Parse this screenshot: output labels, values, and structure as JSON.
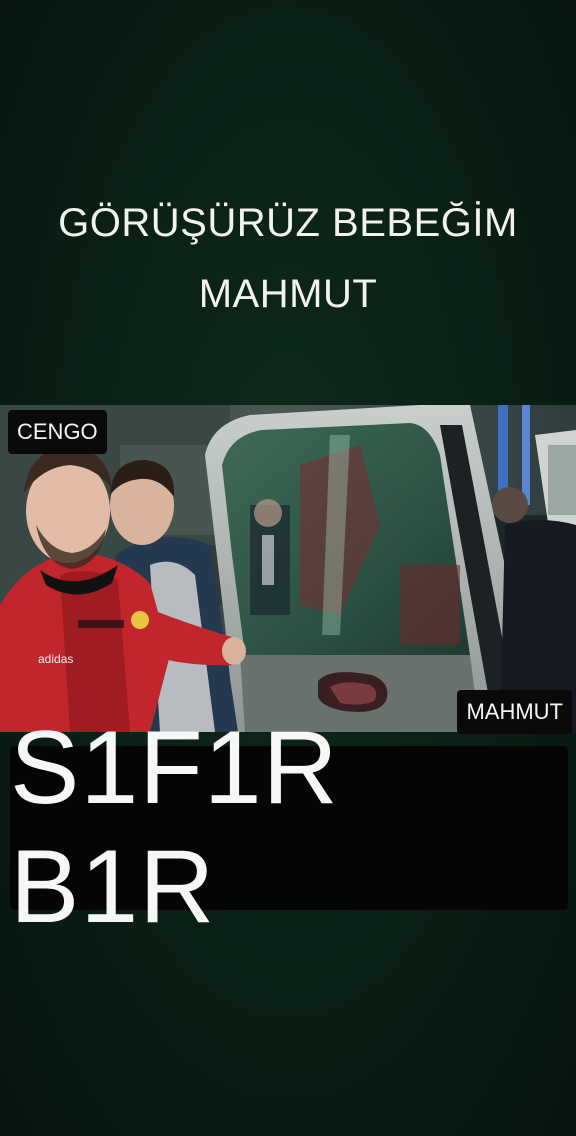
{
  "caption": {
    "line1": "GÖRÜŞÜRÜZ BEBEĞİM",
    "line2": "MAHMUT"
  },
  "video": {
    "label_left": "CENGO",
    "label_right": "MAHMUT",
    "jersey_text": "adidas"
  },
  "title": {
    "text": "S1F1R B1R"
  },
  "colors": {
    "background": "#0a1f15",
    "caption_text": "#f2f2ee",
    "label_background": "#0a0a0a",
    "title_background": "#050505",
    "title_text": "#f7f7f7"
  }
}
